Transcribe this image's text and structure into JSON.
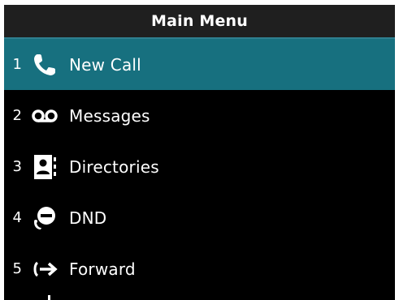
{
  "header": {
    "title": "Main Menu"
  },
  "menu": {
    "items": [
      {
        "number": "1",
        "label": "New Call",
        "icon": "phone-icon",
        "selected": true
      },
      {
        "number": "2",
        "label": "Messages",
        "icon": "voicemail-icon",
        "selected": false
      },
      {
        "number": "3",
        "label": "Directories",
        "icon": "contact-card-icon",
        "selected": false
      },
      {
        "number": "4",
        "label": "DND",
        "icon": "do-not-disturb-icon",
        "selected": false
      },
      {
        "number": "5",
        "label": "Forward",
        "icon": "forward-arrow-icon",
        "selected": false
      }
    ]
  },
  "colors": {
    "background": "#000000",
    "selected_row": "#17707f",
    "title_bar": "#1f1f1f",
    "text": "#ffffff"
  }
}
